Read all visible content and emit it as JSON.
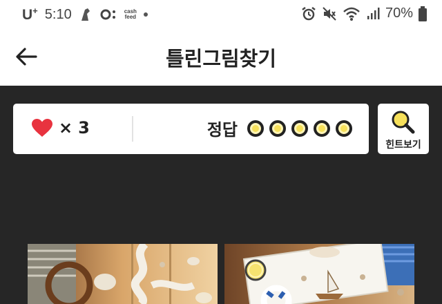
{
  "status_bar": {
    "carrier": "U",
    "carrier_super": "+",
    "time": "5:10",
    "cashfeed_line1": "cash",
    "cashfeed_line2": "feed",
    "battery": "70%"
  },
  "header": {
    "back_icon": "arrow-left",
    "title": "틀린그림찾기"
  },
  "score_card": {
    "lives_multiplier": "×",
    "lives_count": "3",
    "answer_label": "정답",
    "answers_found": 0,
    "answers_total": 5
  },
  "hint_button": {
    "icon": "magnifier",
    "label": "힌트보기"
  },
  "colors": {
    "background": "#262626",
    "heart": "#e8333f",
    "accent_yellow": "#f6e05a"
  }
}
